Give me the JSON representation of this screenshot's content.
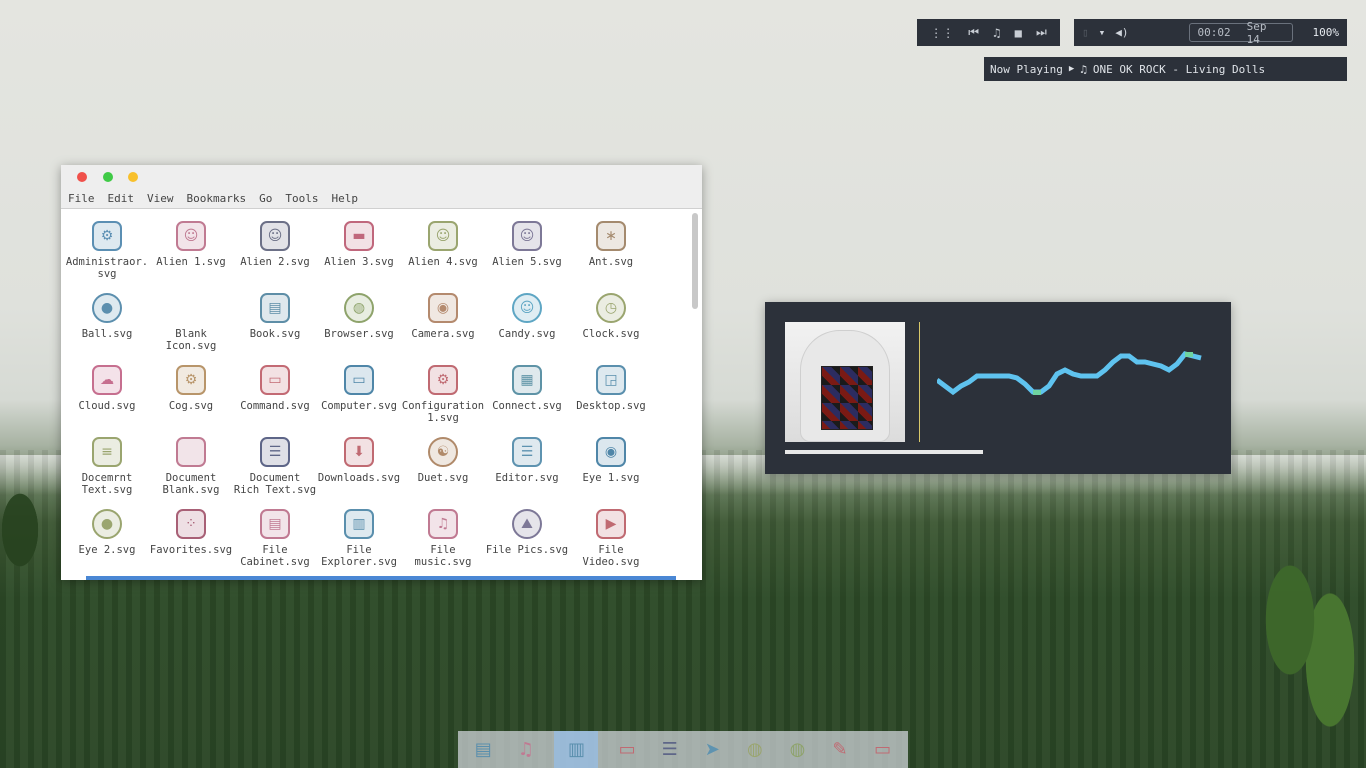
{
  "media_controls": {
    "items": [
      {
        "name": "apps-grid-icon",
        "glyph": "⋮⋮"
      },
      {
        "name": "previous-icon",
        "glyph": "⏮"
      },
      {
        "name": "music-note-icon",
        "glyph": "♫"
      },
      {
        "name": "stop-icon",
        "glyph": "■"
      },
      {
        "name": "next-icon",
        "glyph": "⏭"
      }
    ]
  },
  "status": {
    "time": "00:02",
    "date": "Sep 14",
    "battery": "100%"
  },
  "now_playing": {
    "label": "Now Playing",
    "track": "ONE OK ROCK - Living Dolls"
  },
  "window": {
    "menu": [
      "File",
      "Edit",
      "View",
      "Bookmarks",
      "Go",
      "Tools",
      "Help"
    ],
    "files": [
      {
        "label": "Administraor.\nsvg",
        "icon": "gear-wrench-icon",
        "glyph": "⚙",
        "color": "#5b8fb3"
      },
      {
        "label": "Alien 1.svg",
        "icon": "alien-1-icon",
        "glyph": "☺",
        "color": "#c07a92"
      },
      {
        "label": "Alien 2.svg",
        "icon": "alien-2-icon",
        "glyph": "☺",
        "color": "#6c7087"
      },
      {
        "label": "Alien 3.svg",
        "icon": "alien-3-icon",
        "glyph": "▬",
        "color": "#c0677c"
      },
      {
        "label": "Alien 4.svg",
        "icon": "alien-4-icon",
        "glyph": "☺",
        "color": "#9aa56f"
      },
      {
        "label": "Alien 5.svg",
        "icon": "alien-5-icon",
        "glyph": "☺",
        "color": "#7d7897"
      },
      {
        "label": "Ant.svg",
        "icon": "ant-icon",
        "glyph": "∗",
        "color": "#a48a6e"
      },
      {
        "label": "Ball.svg",
        "icon": "ball-icon",
        "glyph": "●",
        "color": "#5c8fae"
      },
      {
        "label": "Blank\nIcon.svg",
        "icon": "blank-icon",
        "glyph": "",
        "color": "#ffffff"
      },
      {
        "label": "Book.svg",
        "icon": "book-icon",
        "glyph": "▤",
        "color": "#5e8ea7"
      },
      {
        "label": "Browser.svg",
        "icon": "browser-globe-icon",
        "glyph": "◍",
        "color": "#8ea36b"
      },
      {
        "label": "Camera.svg",
        "icon": "camera-icon",
        "glyph": "◉",
        "color": "#b48a6e"
      },
      {
        "label": "Candy.svg",
        "icon": "candy-icon",
        "glyph": "☺",
        "color": "#5ea6c4"
      },
      {
        "label": "Clock.svg",
        "icon": "clock-icon",
        "glyph": "◷",
        "color": "#9aa56f"
      },
      {
        "label": "Cloud.svg",
        "icon": "cloud-icon",
        "glyph": "☁",
        "color": "#c66f8f"
      },
      {
        "label": "Cog.svg",
        "icon": "cog-icon",
        "glyph": "⚙",
        "color": "#b8956a"
      },
      {
        "label": "Command.svg",
        "icon": "command-window-icon",
        "glyph": "▭",
        "color": "#c36a74"
      },
      {
        "label": "Computer.svg",
        "icon": "laptop-icon",
        "glyph": "▭",
        "color": "#4f86a8"
      },
      {
        "label": "Configuration\n1.svg",
        "icon": "configuration-icon",
        "glyph": "⚙",
        "color": "#c06a72"
      },
      {
        "label": "Connect.svg",
        "icon": "connect-grid-icon",
        "glyph": "▦",
        "color": "#5e93a6"
      },
      {
        "label": "Desktop.svg",
        "icon": "desktop-icon",
        "glyph": "◲",
        "color": "#5a8fad"
      },
      {
        "label": "Docemrnt\nText.svg",
        "icon": "document-text-icon",
        "glyph": "≡",
        "color": "#9aa56f"
      },
      {
        "label": "Document\nBlank.svg",
        "icon": "document-blank-icon",
        "glyph": "",
        "color": "#c07a92"
      },
      {
        "label": "Document\nRich Text.svg",
        "icon": "document-rich-text-icon",
        "glyph": "☰",
        "color": "#5e6688"
      },
      {
        "label": "Downloads.svg",
        "icon": "downloads-icon",
        "glyph": "⬇",
        "color": "#c06a72"
      },
      {
        "label": "Duet.svg",
        "icon": "duet-icon",
        "glyph": "☯",
        "color": "#b08a6a"
      },
      {
        "label": "Editor.svg",
        "icon": "database-icon",
        "glyph": "☰",
        "color": "#5e93b0"
      },
      {
        "label": "Eye 1.svg",
        "icon": "eye-icon",
        "glyph": "◉",
        "color": "#4f86a8"
      },
      {
        "label": "Eye 2.svg",
        "icon": "eye-2-icon",
        "glyph": "●",
        "color": "#9aa56f"
      },
      {
        "label": "Favorites.svg",
        "icon": "favorites-dots-icon",
        "glyph": "⁘",
        "color": "#a86076"
      },
      {
        "label": "File\nCabinet.svg",
        "icon": "file-cabinet-icon",
        "glyph": "▤",
        "color": "#c07a92"
      },
      {
        "label": "File\nExplorer.svg",
        "icon": "file-explorer-icon",
        "glyph": "▥",
        "color": "#5a8fad"
      },
      {
        "label": "File\nmusic.svg",
        "icon": "file-music-icon",
        "glyph": "♫",
        "color": "#c07a92"
      },
      {
        "label": "File Pics.svg",
        "icon": "file-pics-icon",
        "glyph": "⛰",
        "color": "#7d7897"
      },
      {
        "label": "File\nVideo.svg",
        "icon": "file-video-icon",
        "glyph": "▶",
        "color": "#c06a72"
      }
    ]
  },
  "dock": {
    "items": [
      {
        "name": "files-icon",
        "glyph": "▤",
        "color": "#5a8fad"
      },
      {
        "name": "music-icon",
        "glyph": "♫",
        "color": "#c07a92"
      },
      {
        "name": "file-explorer-icon",
        "glyph": "▥",
        "color": "#5a8fad",
        "active": true
      },
      {
        "name": "window-icon",
        "glyph": "▭",
        "color": "#c06a72"
      },
      {
        "name": "document-icon",
        "glyph": "☰",
        "color": "#5e6688"
      },
      {
        "name": "telegram-icon",
        "glyph": "➤",
        "color": "#5e93b0"
      },
      {
        "name": "network-globe-icon",
        "glyph": "◍",
        "color": "#9aa56f"
      },
      {
        "name": "browser-icon",
        "glyph": "◍",
        "color": "#8ea36b"
      },
      {
        "name": "editor-icon",
        "glyph": "✎",
        "color": "#c06a72"
      },
      {
        "name": "terminal-icon",
        "glyph": "▭",
        "color": "#c06a72"
      }
    ]
  }
}
